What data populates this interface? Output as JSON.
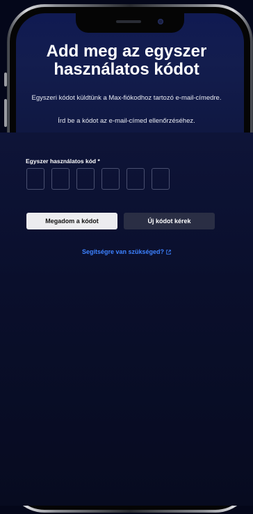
{
  "page": {
    "title": "Add meg az egyszer használatos kódot",
    "subtitle": "Egyszeri kódot küldtünk a Max-fiókodhoz tartozó e-mail-címedre.",
    "instruction": "Írd be a kódot az e-mail-címed ellenőrzéséhez."
  },
  "otp": {
    "label": "Egyszer használatos kód *",
    "digits": [
      "",
      "",
      "",
      "",
      "",
      ""
    ]
  },
  "actions": {
    "submit_label": "Megadom a kódot",
    "resend_label": "Új kódot kérek"
  },
  "help": {
    "label": "Segítségre van szükséged?",
    "icon": "external-link-icon"
  },
  "colors": {
    "background": "#04071a",
    "link": "#3d82ff",
    "primary_button": "#ececef",
    "secondary_button": "#2a2e44"
  }
}
